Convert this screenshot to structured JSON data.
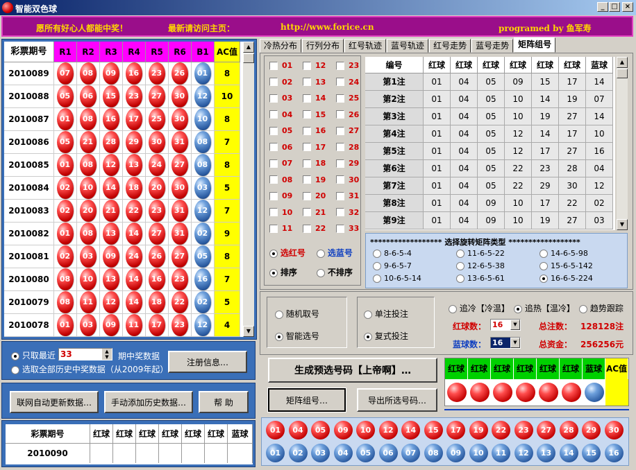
{
  "window": {
    "title": "智能双色球",
    "min": "_",
    "max": "□",
    "close": "×"
  },
  "banner": {
    "slogan": "愿所有好心人都能中奖！",
    "visit": "最新请访问主页：",
    "url": "http://www.forice.cn",
    "author": "programed by 鱼军寿"
  },
  "left_table": {
    "headers": [
      "彩票期号",
      "R1",
      "R2",
      "R3",
      "R4",
      "R5",
      "R6",
      "B1",
      "AC值"
    ],
    "rows": [
      {
        "issue": "2010089",
        "reds": [
          "07",
          "08",
          "09",
          "16",
          "23",
          "26"
        ],
        "blue": "01",
        "ac": "8"
      },
      {
        "issue": "2010088",
        "reds": [
          "05",
          "06",
          "15",
          "23",
          "27",
          "30"
        ],
        "blue": "12",
        "ac": "10"
      },
      {
        "issue": "2010087",
        "reds": [
          "01",
          "08",
          "16",
          "17",
          "25",
          "30"
        ],
        "blue": "10",
        "ac": "8"
      },
      {
        "issue": "2010086",
        "reds": [
          "05",
          "21",
          "28",
          "29",
          "30",
          "31"
        ],
        "blue": "08",
        "ac": "7"
      },
      {
        "issue": "2010085",
        "reds": [
          "01",
          "08",
          "12",
          "13",
          "24",
          "27"
        ],
        "blue": "08",
        "ac": "8"
      },
      {
        "issue": "2010084",
        "reds": [
          "02",
          "10",
          "14",
          "18",
          "20",
          "30"
        ],
        "blue": "03",
        "ac": "5"
      },
      {
        "issue": "2010083",
        "reds": [
          "02",
          "20",
          "21",
          "22",
          "23",
          "31"
        ],
        "blue": "12",
        "ac": "7"
      },
      {
        "issue": "2010082",
        "reds": [
          "01",
          "08",
          "13",
          "14",
          "27",
          "31"
        ],
        "blue": "02",
        "ac": "9"
      },
      {
        "issue": "2010081",
        "reds": [
          "02",
          "03",
          "09",
          "24",
          "26",
          "27"
        ],
        "blue": "05",
        "ac": "8"
      },
      {
        "issue": "2010080",
        "reds": [
          "08",
          "10",
          "13",
          "14",
          "16",
          "23"
        ],
        "blue": "16",
        "ac": "7"
      },
      {
        "issue": "2010079",
        "reds": [
          "08",
          "11",
          "12",
          "14",
          "18",
          "22"
        ],
        "blue": "02",
        "ac": "5"
      },
      {
        "issue": "2010078",
        "reds": [
          "01",
          "03",
          "09",
          "11",
          "17",
          "23"
        ],
        "blue": "12",
        "ac": "4"
      }
    ]
  },
  "data_options": {
    "recent_label": "只取最近",
    "recent_value": "33",
    "recent_suffix": "期中奖数据",
    "all_label": "选取全部历史中奖数据（从2009年起）",
    "register_btn": "注册信息…"
  },
  "buttons": {
    "auto_update": "联网自动更新数据…",
    "manual_add": "手动添加历史数据…",
    "help": "帮  助"
  },
  "bottom_left_table": {
    "headers": [
      "彩票期号",
      "红球",
      "红球",
      "红球",
      "红球",
      "红球",
      "红球",
      "蓝球"
    ],
    "issue": "2010090"
  },
  "tabs": [
    "冷热分布",
    "行列分布",
    "红号轨迹",
    "蓝号轨迹",
    "红号走势",
    "蓝号走势",
    "矩阵组号"
  ],
  "checkbox_numbers": [
    "01",
    "02",
    "03",
    "04",
    "05",
    "06",
    "07",
    "08",
    "09",
    "10",
    "11",
    "12",
    "13",
    "14",
    "15",
    "16",
    "17",
    "18",
    "19",
    "20",
    "21",
    "22",
    "23",
    "24",
    "25",
    "26",
    "27",
    "28",
    "29",
    "30",
    "31",
    "32",
    "33"
  ],
  "pick_options": {
    "red": "选红号",
    "blue": "选蓝号",
    "sort": "排序",
    "nosort": "不排序"
  },
  "matrix_table": {
    "headers": [
      "编号",
      "红球",
      "红球",
      "红球",
      "红球",
      "红球",
      "红球",
      "蓝球"
    ],
    "rows": [
      [
        "第1注",
        "01",
        "04",
        "05",
        "09",
        "15",
        "17",
        "14"
      ],
      [
        "第2注",
        "01",
        "04",
        "05",
        "10",
        "14",
        "19",
        "07"
      ],
      [
        "第3注",
        "01",
        "04",
        "05",
        "10",
        "19",
        "27",
        "14"
      ],
      [
        "第4注",
        "01",
        "04",
        "05",
        "12",
        "14",
        "17",
        "10"
      ],
      [
        "第5注",
        "01",
        "04",
        "05",
        "12",
        "17",
        "27",
        "16"
      ],
      [
        "第6注",
        "01",
        "04",
        "05",
        "22",
        "23",
        "28",
        "04"
      ],
      [
        "第7注",
        "01",
        "04",
        "05",
        "22",
        "29",
        "30",
        "12"
      ],
      [
        "第8注",
        "01",
        "04",
        "09",
        "10",
        "17",
        "22",
        "02"
      ],
      [
        "第9注",
        "01",
        "04",
        "09",
        "10",
        "19",
        "27",
        "03"
      ]
    ]
  },
  "matrix_types": {
    "title": "****************** 选择旋转矩阵类型 ******************",
    "options": [
      "8-6-5-4",
      "11-6-5-22",
      "14-6-5-98",
      "9-6-5-7",
      "12-6-5-38",
      "15-6-5-142",
      "10-6-5-14",
      "13-6-5-61",
      "16-6-5-224"
    ],
    "selected": "16-6-5-224"
  },
  "mode": {
    "random": "随机取号",
    "smart": "智能选号",
    "single": "单注投注",
    "multi": "复式投注",
    "cold": "追冷【冷温】",
    "hot": "追热【温冷】",
    "trend": "趋势跟踪",
    "red_count_label": "红球数：",
    "red_count": "16",
    "blue_count_label": "蓝球数：",
    "blue_count": "16",
    "total_bets_label": "总注数：",
    "total_bets": "128128注",
    "total_money_label": "总资金：",
    "total_money": "256256元"
  },
  "actions": {
    "generate": "生成预选号码【上帝啊】…",
    "matrix": "矩阵组号…",
    "export": "导出所选号码…"
  },
  "result_headers": [
    "红球",
    "红球",
    "红球",
    "红球",
    "红球",
    "红球",
    "蓝球",
    "AC值"
  ],
  "pool_red": [
    "01",
    "04",
    "05",
    "09",
    "10",
    "12",
    "14",
    "15",
    "17",
    "19",
    "22",
    "23",
    "27",
    "28",
    "29",
    "30"
  ],
  "pool_blue": [
    "01",
    "02",
    "03",
    "04",
    "05",
    "06",
    "07",
    "08",
    "09",
    "10",
    "11",
    "12",
    "13",
    "14",
    "15",
    "16"
  ],
  "colors": {
    "banner_bg": "#9a0e8a",
    "header_magenta": "#ff00ff",
    "header_green": "#00d000",
    "ac_yellow": "#ffff00",
    "red_ball": "#d00000",
    "blue_ball": "#2a5aa0"
  }
}
